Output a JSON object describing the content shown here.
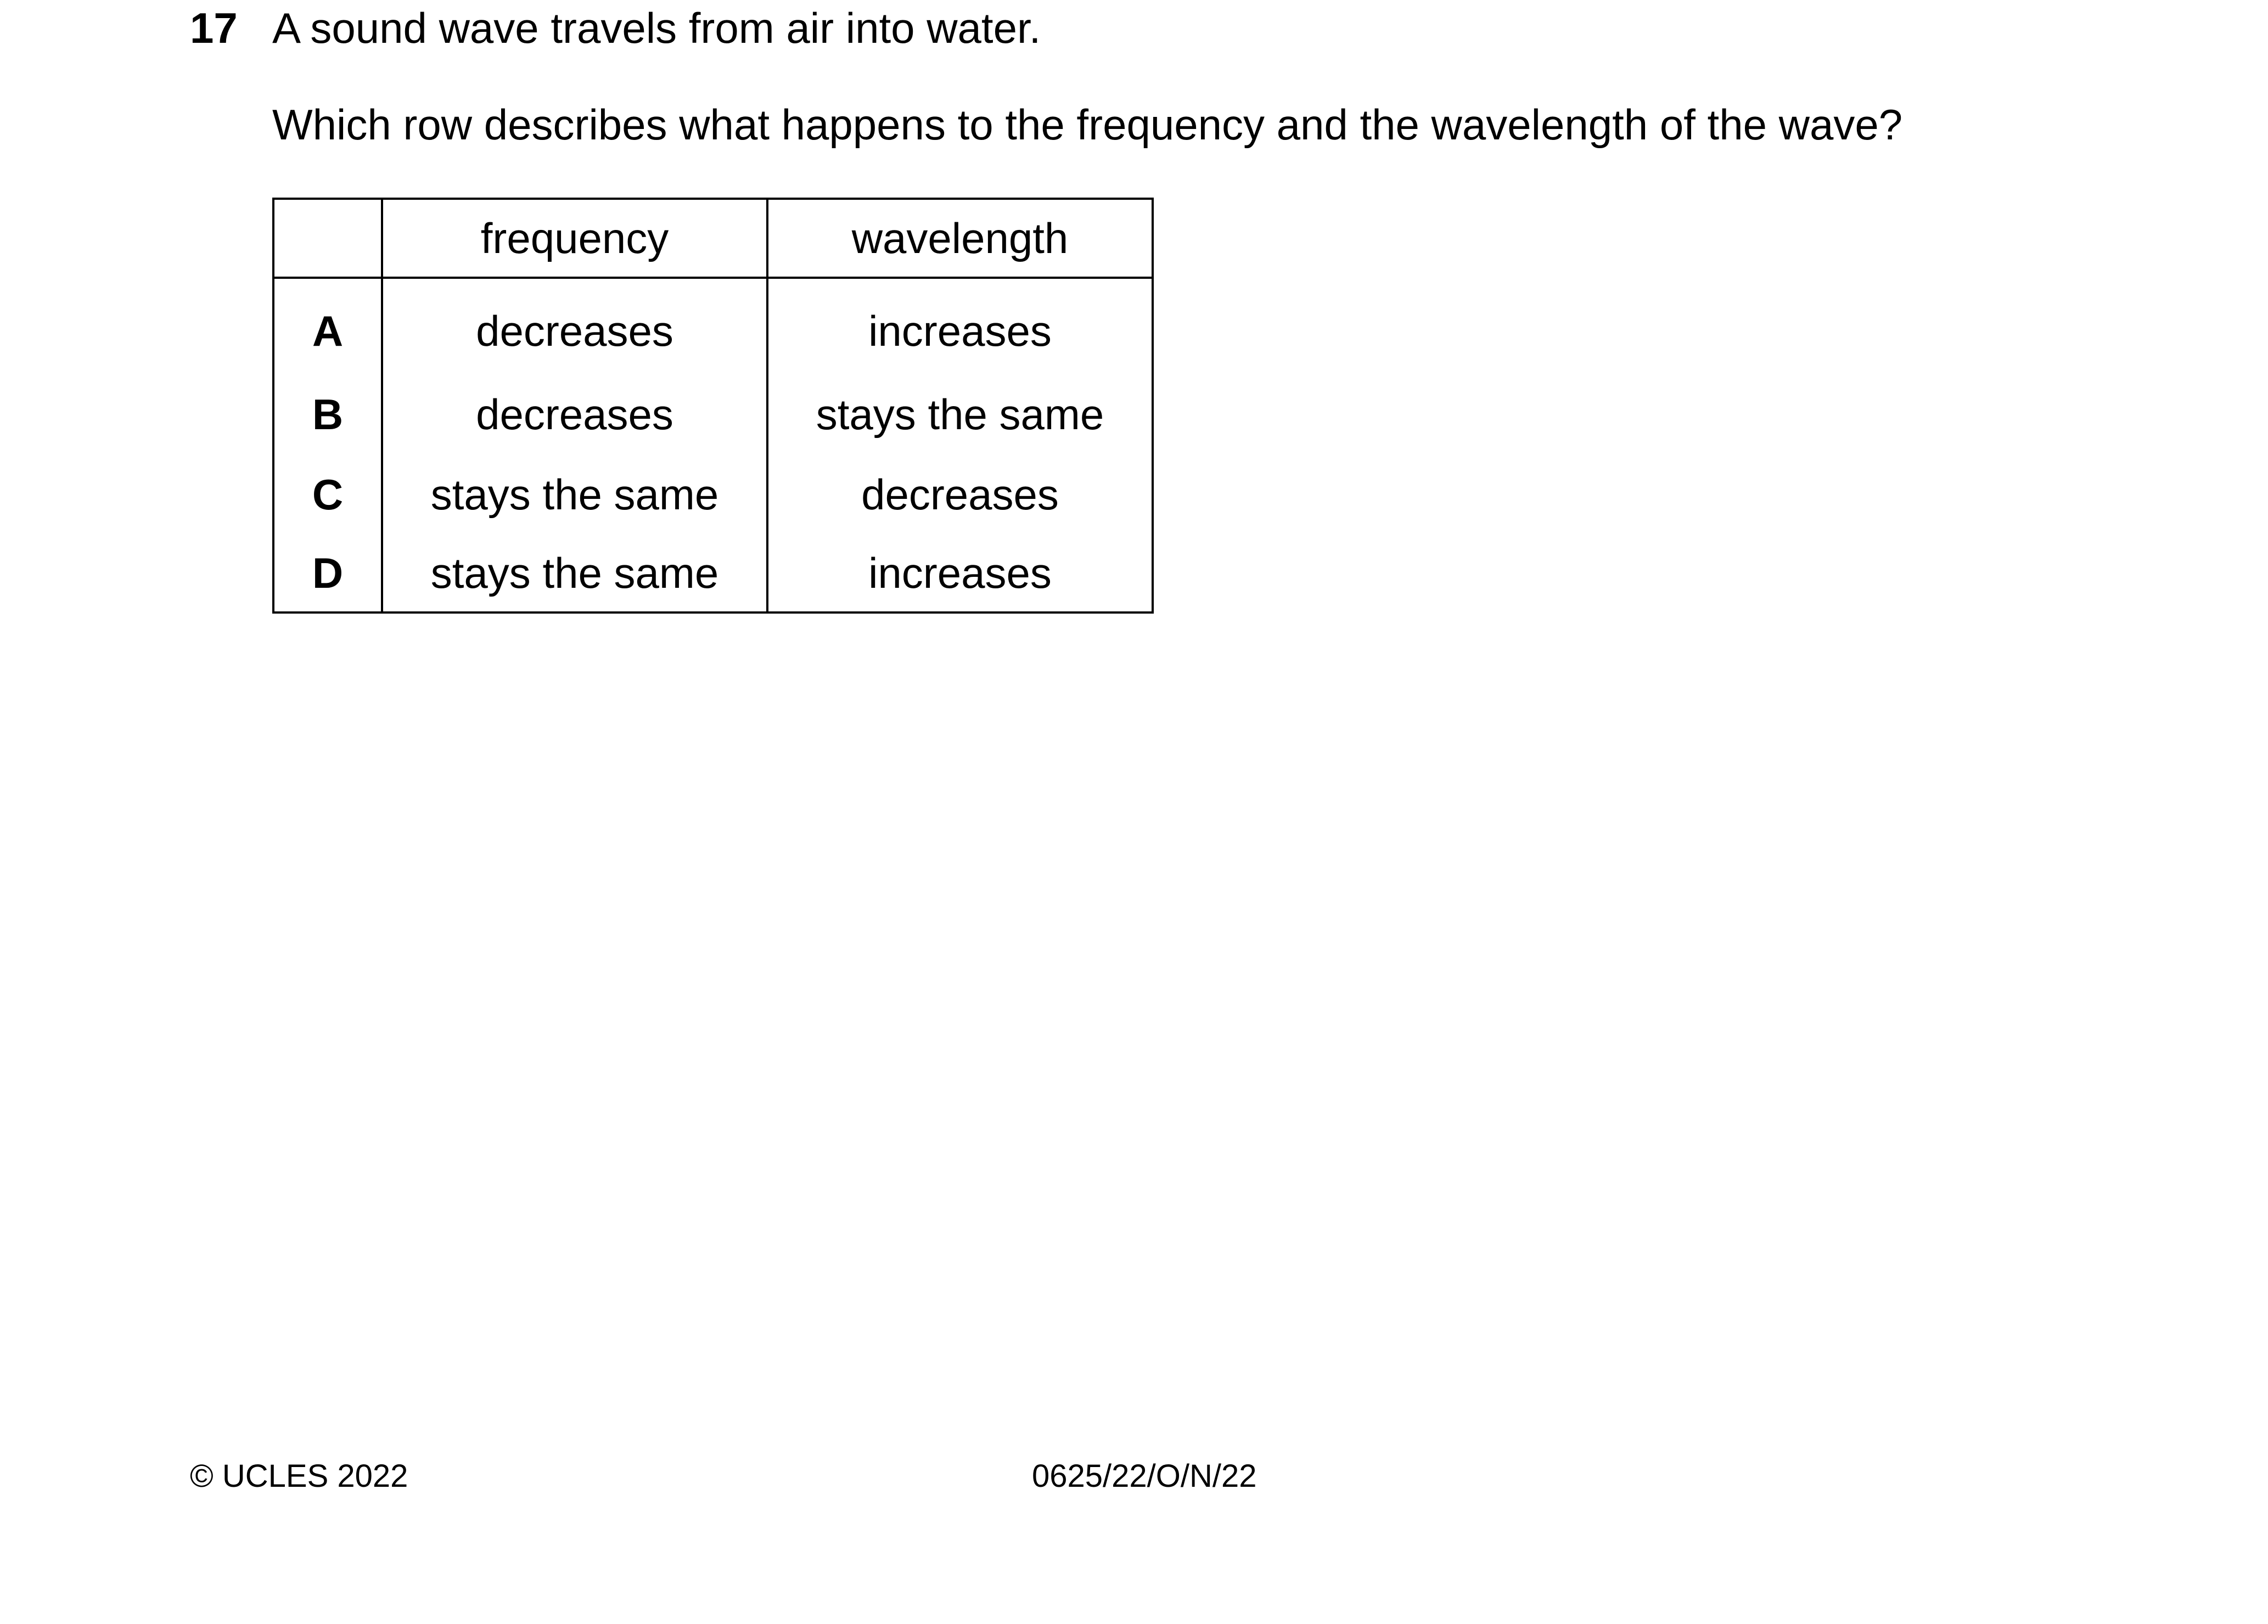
{
  "question": {
    "number": "17",
    "stem": "A sound wave travels from air into water.",
    "prompt": "Which row describes what happens to the frequency and the wavelength of the wave?"
  },
  "table": {
    "headers": [
      "",
      "frequency",
      "wavelength"
    ],
    "rows": [
      {
        "key": "A",
        "frequency": "decreases",
        "wavelength": "increases"
      },
      {
        "key": "B",
        "frequency": "decreases",
        "wavelength": "stays the same"
      },
      {
        "key": "C",
        "frequency": "stays the same",
        "wavelength": "decreases"
      },
      {
        "key": "D",
        "frequency": "stays the same",
        "wavelength": "increases"
      }
    ]
  },
  "footer": {
    "copyright": "© UCLES 2022",
    "paper_code": "0625/22/O/N/22"
  }
}
